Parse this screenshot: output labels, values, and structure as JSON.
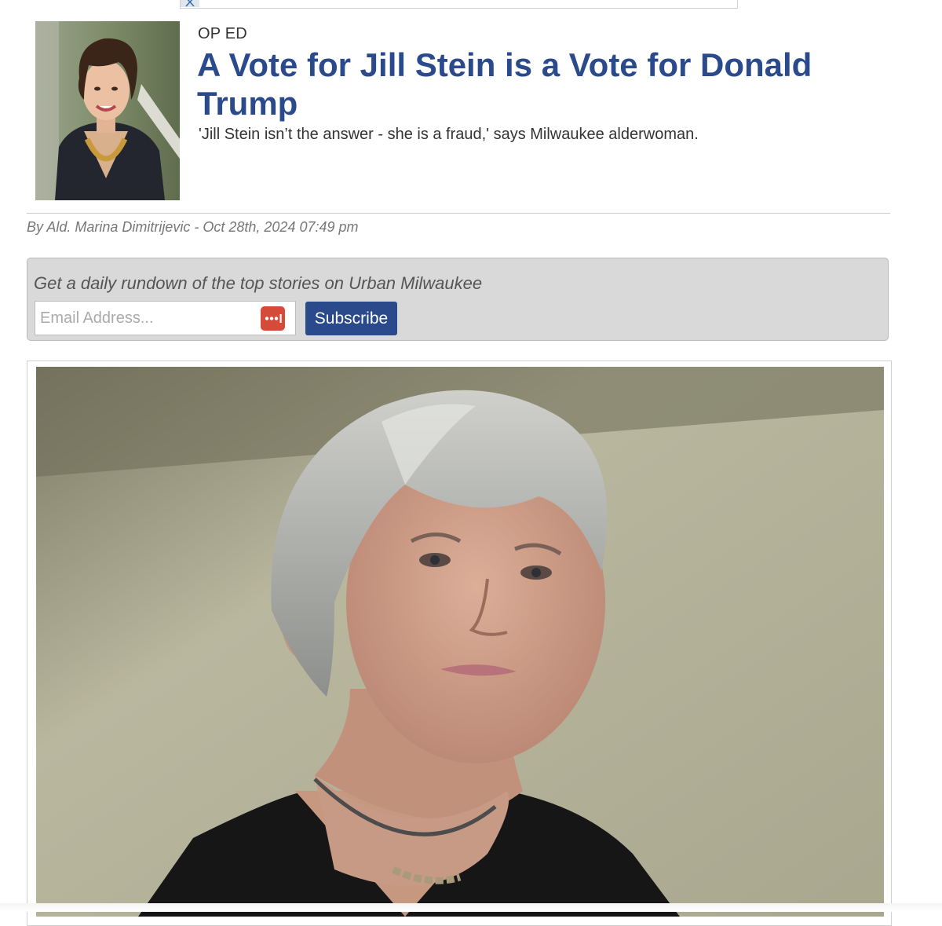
{
  "ad": {
    "close_icon": "close-x-icon"
  },
  "article": {
    "kicker": "OP ED",
    "title": "A Vote for Jill Stein is a Vote for Donald Trump",
    "dek": "'Jill Stein isn’t the answer - she is a fraud,' says Milwaukee alderwoman.",
    "byline": "By Ald. Marina Dimitrijevic - Oct 28th, 2024 07:49 pm"
  },
  "newsletter": {
    "prompt": "Get a daily rundown of the top stories on Urban Milwaukee",
    "email_placeholder": "Email Address...",
    "email_value": "",
    "password_manager_icon": "password-manager-icon",
    "subscribe_label": "Subscribe"
  },
  "colors": {
    "headline": "#2a4a8c",
    "button": "#2a4a8c",
    "newsletter_bg": "#d9d9d9",
    "password_icon": "#d64a3a"
  }
}
